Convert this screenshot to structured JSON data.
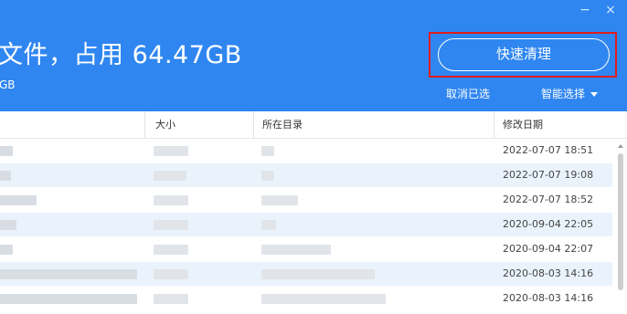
{
  "header": {
    "title": "文件，占用 64.47GB",
    "subtitle": "GB",
    "quick_clean_label": "快速清理",
    "cancel_selection_label": "取消已选",
    "smart_select_label": "智能选择",
    "minimize_symbol": "−",
    "close_symbol": "×",
    "accent_color": "#2f86f0",
    "highlight_color": "#e21c1c"
  },
  "table": {
    "columns": [
      {
        "key": "name",
        "label": ""
      },
      {
        "key": "size",
        "label": "大小"
      },
      {
        "key": "dir",
        "label": "所在目录"
      },
      {
        "key": "modified",
        "label": "修改日期"
      }
    ],
    "rows": [
      {
        "modified": "2022-07-07 18:51"
      },
      {
        "modified": "2022-07-07 19:08"
      },
      {
        "modified": "2022-07-07 18:52"
      },
      {
        "modified": "2020-09-04 22:05"
      },
      {
        "modified": "2020-09-04 22:07"
      },
      {
        "modified": "2020-08-03 14:16"
      },
      {
        "modified": "2020-08-03 14:16"
      }
    ]
  }
}
